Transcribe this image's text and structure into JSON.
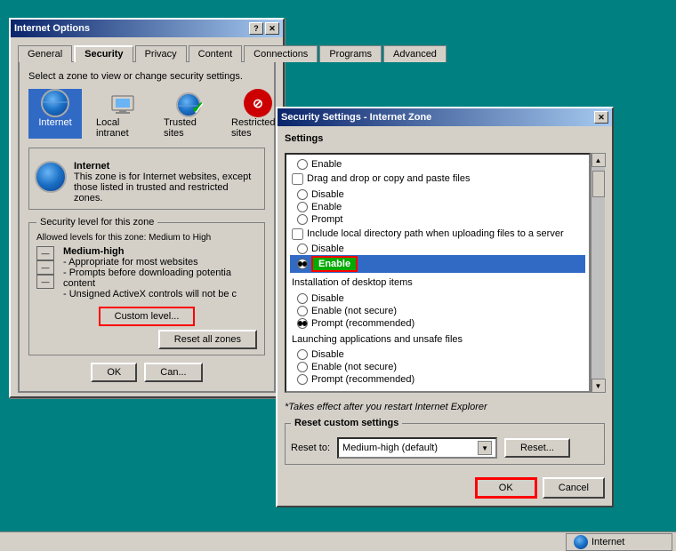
{
  "internetOptions": {
    "title": "Internet Options",
    "tabs": [
      "General",
      "Security",
      "Privacy",
      "Content",
      "Connections",
      "Programs",
      "Advanced"
    ],
    "activeTab": "Security",
    "instruction": "Select a zone to view or change security settings.",
    "zones": [
      {
        "id": "internet",
        "label": "Internet",
        "type": "globe"
      },
      {
        "id": "local-intranet",
        "label": "Local intranet",
        "type": "intranet"
      },
      {
        "id": "trusted-sites",
        "label": "Trusted sites",
        "type": "trusted"
      },
      {
        "id": "restricted",
        "label": "Restricted sites",
        "type": "restricted"
      }
    ],
    "securityZoneTitle": "Internet",
    "securityZoneDesc": "This zone is for Internet websites, except those listed in trusted and restricted zones.",
    "securityLevelLabel": "Security level for this zone",
    "allowedLevels": "Allowed levels for this zone: Medium to High",
    "levelName": "Medium-high",
    "levelBullets": [
      "Appropriate for most websites",
      "Prompts before downloading potentia content",
      "Unsigned ActiveX controls will not be c"
    ],
    "customLevelBtn": "Custom level...",
    "resetAllZonesBtn": "Reset all zones",
    "okBtn": "OK",
    "cancelBtn": "Can..."
  },
  "securitySettings": {
    "title": "Security Settings - Internet Zone",
    "settingsLabel": "Settings",
    "items": [
      {
        "type": "radio",
        "label": "Enable",
        "selected": false
      },
      {
        "type": "checkbox",
        "label": "Drag and drop or copy and paste files"
      },
      {
        "type": "radio",
        "label": "Disable",
        "selected": false
      },
      {
        "type": "radio",
        "label": "Enable",
        "selected": false
      },
      {
        "type": "radio",
        "label": "Prompt",
        "selected": false
      },
      {
        "type": "checkbox",
        "label": "Include local directory path when uploading files to a server"
      },
      {
        "type": "radio",
        "label": "Disable",
        "selected": false
      },
      {
        "type": "radio",
        "label": "Enable",
        "selected": true,
        "highlighted": true
      },
      {
        "type": "section",
        "label": "Installation of desktop items"
      },
      {
        "type": "radio",
        "label": "Disable",
        "selected": false
      },
      {
        "type": "radio",
        "label": "Enable (not secure)",
        "selected": false
      },
      {
        "type": "radio",
        "label": "Prompt (recommended)",
        "selected": true
      },
      {
        "type": "section",
        "label": "Launching applications and unsafe files"
      },
      {
        "type": "radio",
        "label": "Disable",
        "selected": false
      },
      {
        "type": "radio",
        "label": "Enable (not secure)",
        "selected": false
      },
      {
        "type": "radio",
        "label": "Prompt (recommended)",
        "selected": false
      }
    ],
    "note": "*Takes effect after you restart Internet Explorer",
    "resetSection": "Reset custom settings",
    "resetToLabel": "Reset to:",
    "resetToValue": "Medium-high (default)",
    "resetBtn": "Reset...",
    "okBtn": "OK",
    "cancelBtn": "Cancel"
  },
  "statusBar": {
    "zoneLabel": "Internet"
  }
}
